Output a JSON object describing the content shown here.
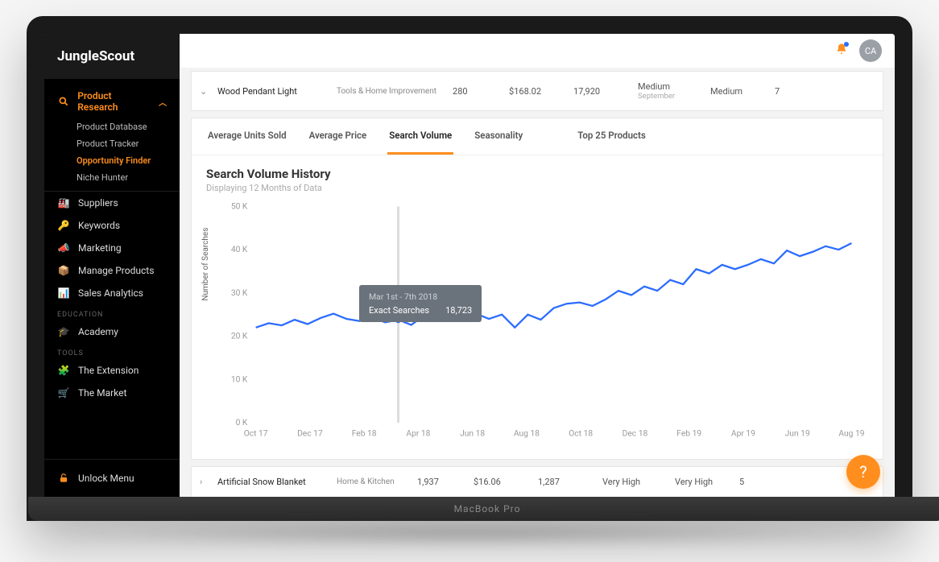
{
  "brand": "JungleScout",
  "avatar_initials": "CA",
  "sidebar": {
    "primary": {
      "label": "Product Research"
    },
    "sub": [
      "Product Database",
      "Product Tracker",
      "Opportunity Finder",
      "Niche Hunter"
    ],
    "sub_selected": 2,
    "groups": [
      {
        "icon": "🏭",
        "label": "Suppliers"
      },
      {
        "icon": "🔑",
        "label": "Keywords"
      },
      {
        "icon": "📣",
        "label": "Marketing"
      },
      {
        "icon": "📦",
        "label": "Manage Products"
      },
      {
        "icon": "📊",
        "label": "Sales Analytics"
      }
    ],
    "education_header": "EDUCATION",
    "education": [
      {
        "icon": "🎓",
        "label": "Academy"
      }
    ],
    "tools_header": "TOOLS",
    "tools": [
      {
        "icon": "🧩",
        "label": "The Extension"
      },
      {
        "icon": "🛒",
        "label": "The Market"
      }
    ],
    "unlock": "Unlock Menu"
  },
  "product_row_top": {
    "name": "Wood Pendant Light",
    "category": "Tools & Home Improvement",
    "col1": "280",
    "col2": "$168.02",
    "col3": "17,920",
    "col4": "Medium",
    "col4_sub": "September",
    "col5": "Medium",
    "col6": "7"
  },
  "product_row_bottom": {
    "name": "Artificial Snow Blanket",
    "category": "Home & Kitchen",
    "col1": "1,937",
    "col2": "$16.06",
    "col3": "1,287",
    "col4": "Very High",
    "col5": "Very High",
    "col6": "5"
  },
  "tabs": [
    "Average Units Sold",
    "Average Price",
    "Search Volume",
    "Seasonality"
  ],
  "tabs_right": "Top 25 Products",
  "tabs_selected": 2,
  "chart": {
    "title": "Search Volume History",
    "subtitle": "Displaying 12 Months of Data",
    "ylabel": "Number of Searches"
  },
  "tooltip": {
    "head": "Mar 1st - 7th 2018",
    "label": "Exact Searches",
    "value": "18,723"
  },
  "chart_data": {
    "type": "line",
    "title": "Search Volume History",
    "ylabel": "Number of Searches",
    "ylim": [
      0,
      50000
    ],
    "yticks": [
      "0 K",
      "10 K",
      "20 K",
      "30 K",
      "40 K",
      "50 K"
    ],
    "xticks": [
      "Oct 17",
      "Dec 17",
      "Feb 18",
      "Apr 18",
      "Jun 18",
      "Aug 18",
      "Oct 18",
      "Dec 18",
      "Feb 19",
      "Apr 19",
      "Jun 19",
      "Aug 19"
    ],
    "series": [
      {
        "name": "Exact Searches",
        "color": "#2b6cff",
        "x_index": [
          0,
          1,
          2,
          3,
          4,
          5,
          6,
          7,
          8,
          9,
          10,
          11,
          12,
          13,
          14,
          15,
          16,
          17,
          18,
          19,
          20,
          21,
          22,
          23,
          24,
          25,
          26,
          27,
          28,
          29,
          30,
          31,
          32,
          33,
          34,
          35,
          36,
          37,
          38,
          39,
          40,
          41,
          42,
          43,
          44,
          45,
          46
        ],
        "values": [
          22000,
          23000,
          22500,
          23800,
          22800,
          24200,
          25200,
          24000,
          23500,
          24200,
          23200,
          23800,
          22600,
          24800,
          23800,
          25000,
          24500,
          25200,
          24000,
          25000,
          22000,
          25000,
          23800,
          26500,
          27500,
          27800,
          27000,
          28500,
          30500,
          29500,
          31500,
          30500,
          33000,
          32000,
          35500,
          34500,
          36500,
          35500,
          36500,
          37800,
          36800,
          39800,
          38500,
          39500,
          40800,
          40000,
          41500
        ]
      }
    ]
  },
  "laptop_label": "MacBook Pro"
}
